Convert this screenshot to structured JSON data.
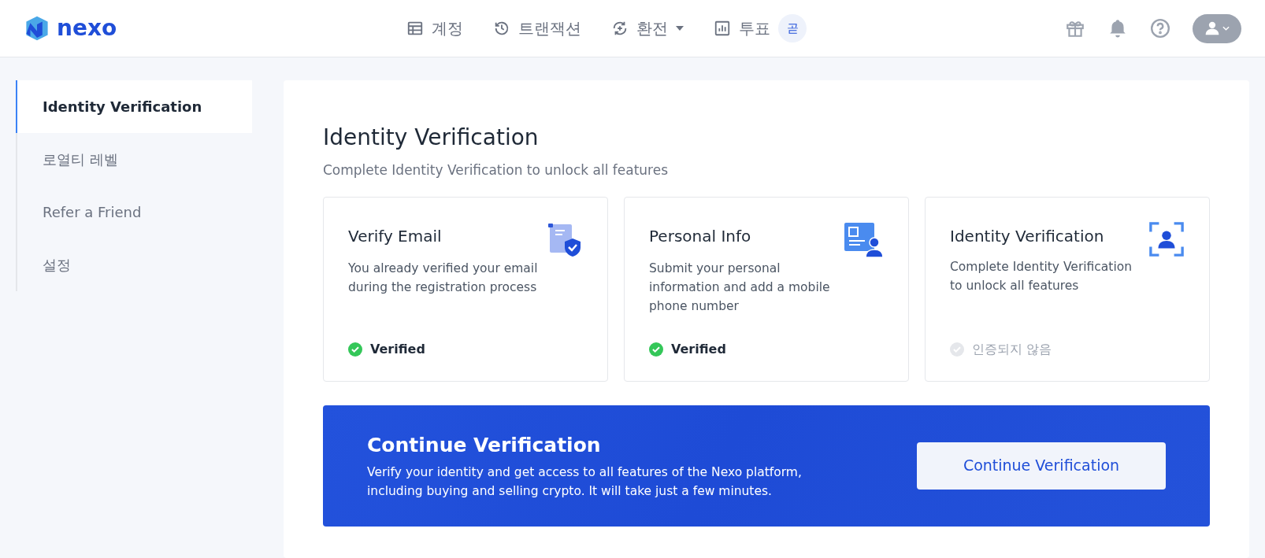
{
  "header": {
    "logo": "nexo",
    "nav": [
      {
        "label": "계정",
        "dropdown": false
      },
      {
        "label": "트랜잭션",
        "dropdown": false
      },
      {
        "label": "환전",
        "dropdown": true
      },
      {
        "label": "투표",
        "dropdown": false,
        "badge": "곧"
      }
    ]
  },
  "sidebar": {
    "items": [
      {
        "label": "Identity Verification",
        "selected": true
      },
      {
        "label": "로열티 레벨",
        "selected": false
      },
      {
        "label": "Refer a Friend",
        "selected": false
      },
      {
        "label": "설정",
        "selected": false
      }
    ]
  },
  "main": {
    "title": "Identity Verification",
    "subtitle": "Complete Identity Verification to unlock all features",
    "cards": [
      {
        "title": "Verify Email",
        "description": "You already verified your email during the registration process",
        "status": "Verified",
        "verified": true
      },
      {
        "title": "Personal Info",
        "description": "Submit your personal information and add a mobile phone number",
        "status": "Verified",
        "verified": true
      },
      {
        "title": "Identity Verification",
        "description": "Complete Identity Verification to unlock all features",
        "status": "인증되지 않음",
        "verified": false
      }
    ],
    "banner": {
      "title": "Continue Verification",
      "text": "Verify your identity and get access to all features of the Nexo platform, including buying and selling crypto. It will take just a few minutes.",
      "button": "Continue Verification"
    }
  }
}
